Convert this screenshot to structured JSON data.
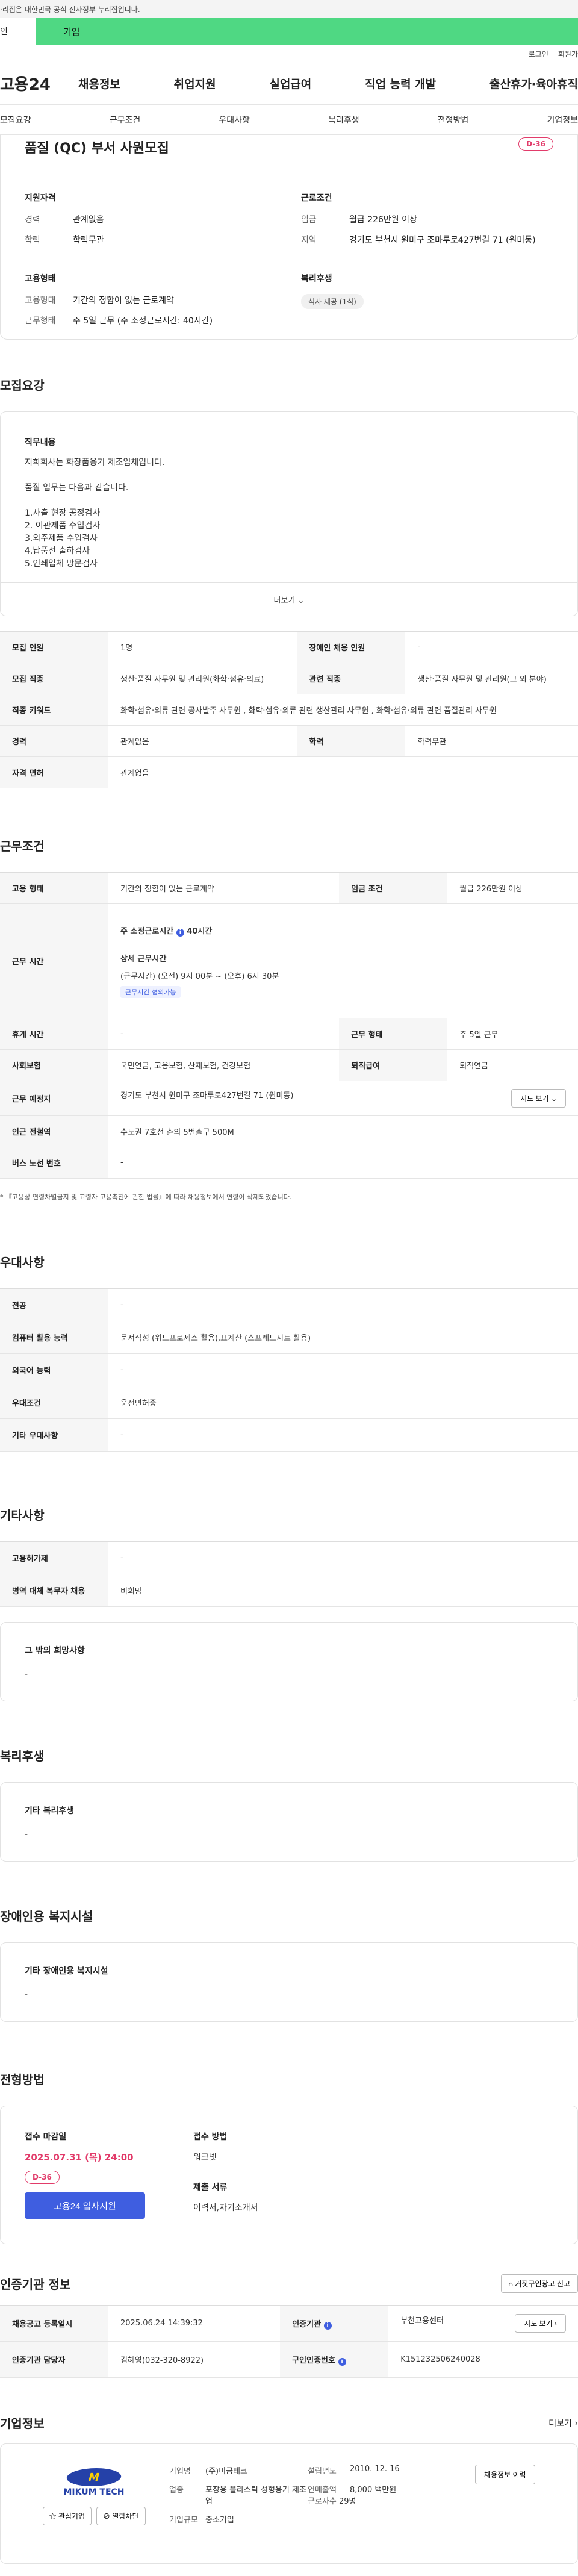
{
  "banner": {
    "text": "·리집은 대한민국 공식 전자정부 누리집입니다."
  },
  "tabs": {
    "person": "인",
    "company": "기업"
  },
  "util": {
    "login": "로그인",
    "join": "회원가"
  },
  "gnb": {
    "logo": "고용24",
    "menu": [
      "채용정보",
      "취업지원",
      "실업급여",
      "직업 능력 개발",
      "출산휴가·육아휴직"
    ]
  },
  "subnav": [
    "모집요강",
    "근무조건",
    "우대사항",
    "복리후생",
    "전형방법",
    "기업정보"
  ],
  "summary": {
    "title": "품질 (QC) 부서 사원모집",
    "dday": "D-36",
    "qualification": {
      "heading": "지원자격",
      "rows": [
        {
          "k": "경력",
          "v": "관계없음"
        },
        {
          "k": "학력",
          "v": "학력무관"
        }
      ]
    },
    "conditions": {
      "heading": "근로조건",
      "rows": [
        {
          "k": "임금",
          "v": "월급 226만원 이상"
        },
        {
          "k": "지역",
          "v": "경기도 부천시 원미구 조마루로427번길 71 (원미동)"
        }
      ]
    },
    "employment": {
      "heading": "고용형태",
      "rows": [
        {
          "k": "고용형태",
          "v": "기간의 정함이 없는 근로계약"
        },
        {
          "k": "근무형태",
          "v": "주 5일 근무 (주 소정근로시간: 40시간)"
        }
      ]
    },
    "welfare": {
      "heading": "복리후생",
      "tag": "식사 제공 (1식)"
    }
  },
  "recruit": {
    "title": "모집요강",
    "desc_heading": "직무내용",
    "desc_lines": [
      "저희회사는 화장품용기 제조업체입니다.",
      "",
      "품질 업무는 다음과 같습니다.",
      "",
      "1.사출 현장 공정검사",
      "2. 이관제품 수입검사",
      "3.외주제품 수입검사",
      "4.납품전 출하검사",
      "5.인쇄업체 방문검사"
    ],
    "more": "더보기 ⌄",
    "table": [
      [
        {
          "k": "모집 인원",
          "v": "1명"
        },
        {
          "k": "장애인 채용 인원",
          "v": "-"
        }
      ],
      [
        {
          "k": "모집 직종",
          "v": "생산·품질 사무원 및 관리원(화학·섬유·의료)"
        },
        {
          "k": "관련 직종",
          "v": "생산·품질 사무원 및 관리원(그 외 분야)"
        }
      ],
      [
        {
          "k": "직종 키워드",
          "v": "화학·섬유·의류 관련 공사발주 사무원 , 화학·섬유·의류 관련 생산관리 사무원 , 화학·섬유·의류 관련 품질관리 사무원"
        }
      ],
      [
        {
          "k": "경력",
          "v": "관계없음"
        },
        {
          "k": "학력",
          "v": "학력무관"
        }
      ],
      [
        {
          "k": "자격 면허",
          "v": "관계없음"
        }
      ]
    ]
  },
  "work": {
    "title": "근무조건",
    "type_k": "고용 형태",
    "type_v": "기간의 정함이 없는 근로계약",
    "wage_k": "임금 조건",
    "wage_v": "월급 226만원 이상",
    "hours_k": "근무 시간",
    "hours_total_label": "주 소정근로시간",
    "hours_total": "40시간",
    "hours_detail_label": "상세 근무시간",
    "hours_detail": "(근무시간) (오전) 9시 00분 ~ (오후) 6시 30분",
    "hours_tag": "근무시간 협의가능",
    "rows": [
      [
        {
          "k": "휴게 시간",
          "v": "-"
        },
        {
          "k": "근무 형태",
          "v": "주 5일 근무"
        }
      ],
      [
        {
          "k": "사회보험",
          "v": "국민연금, 고용보험, 산재보험, 건강보험"
        },
        {
          "k": "퇴직급여",
          "v": "퇴직연금"
        }
      ]
    ],
    "place_k": "근무 예정지",
    "place_v": "경기도 부천시 원미구 조마루로427번길 71 (원미동)",
    "map": "지도 보기 ⌄",
    "subway_k": "인근 전철역",
    "subway_v": "수도권 7호선 춘의 5번출구 500M",
    "bus_k": "버스 노선 번호",
    "bus_v": "-",
    "note": "* 『고용상 연령차별금지 및 고령자 고용촉진에 관한 법률』에 따라 채용정보에서 연령이 삭제되었습니다."
  },
  "prefer": {
    "title": "우대사항",
    "rows": [
      {
        "k": "전공",
        "v": "-"
      },
      {
        "k": "컴퓨터 활용 능력",
        "v": "문서작성 (워드프로세스 활용),표계산 (스프레드시트 활용)"
      },
      {
        "k": "외국어 능력",
        "v": "-"
      },
      {
        "k": "우대조건",
        "v": "운전면허증"
      },
      {
        "k": "기타 우대사항",
        "v": "-"
      }
    ]
  },
  "etc": {
    "title": "기타사항",
    "rows": [
      {
        "k": "고용허가제",
        "v": "-"
      },
      {
        "k": "병역 대체 복무자 채용",
        "v": "비희망"
      }
    ],
    "hope_heading": "그 밖의 희망사항",
    "hope_value": "-"
  },
  "benefits": {
    "title": "복리후생",
    "heading": "기타 복리후생",
    "value": "-"
  },
  "disabled": {
    "title": "장애인용 복지시설",
    "heading": "기타 장애인용 복지시설",
    "value": "-"
  },
  "process": {
    "title": "전형방법",
    "deadline_heading": "접수 마감일",
    "deadline": "2025.07.31 (목) 24:00",
    "dday": "D-36",
    "apply": "고용24 입사지원",
    "method_heading": "접수 방법",
    "method": "워크넷",
    "docs_heading": "제출 서류",
    "docs": "이력서,자기소개서"
  },
  "cert": {
    "title": "인증기관 정보",
    "report": "거짓구인광고 신고",
    "reg_k": "채용공고 등록일시",
    "reg_v": "2025.06.24 14:39:32",
    "org_k": "인증기관",
    "org_v": "부천고용센터",
    "map": "지도 보기 ›",
    "mgr_k": "인증기관 담당자",
    "mgr_v": "김혜영(032-320-8922)",
    "id_k": "구인인증번호",
    "id_v": "K151232506240028"
  },
  "company": {
    "title": "기업정보",
    "more": "더보기 ›",
    "logo_mark": "M",
    "logo_name": "MIKUM TECH",
    "fav": "☆ 관심기업",
    "block": "⊘ 열람차단",
    "name_k": "기업명",
    "name_v": "(주)미금테크",
    "est_k": "설립년도",
    "est_v": "2010. 12. 16",
    "ind_k": "업종",
    "ind_v": "포장용 플라스틱 성형용기 제조업",
    "sales_k": "연매출액",
    "sales_v": "8,000 백만원",
    "emp_k": "근로자수",
    "emp_v": "29명",
    "size_k": "기업규모",
    "size_v": "중소기업",
    "history": "채용정보 이력"
  }
}
